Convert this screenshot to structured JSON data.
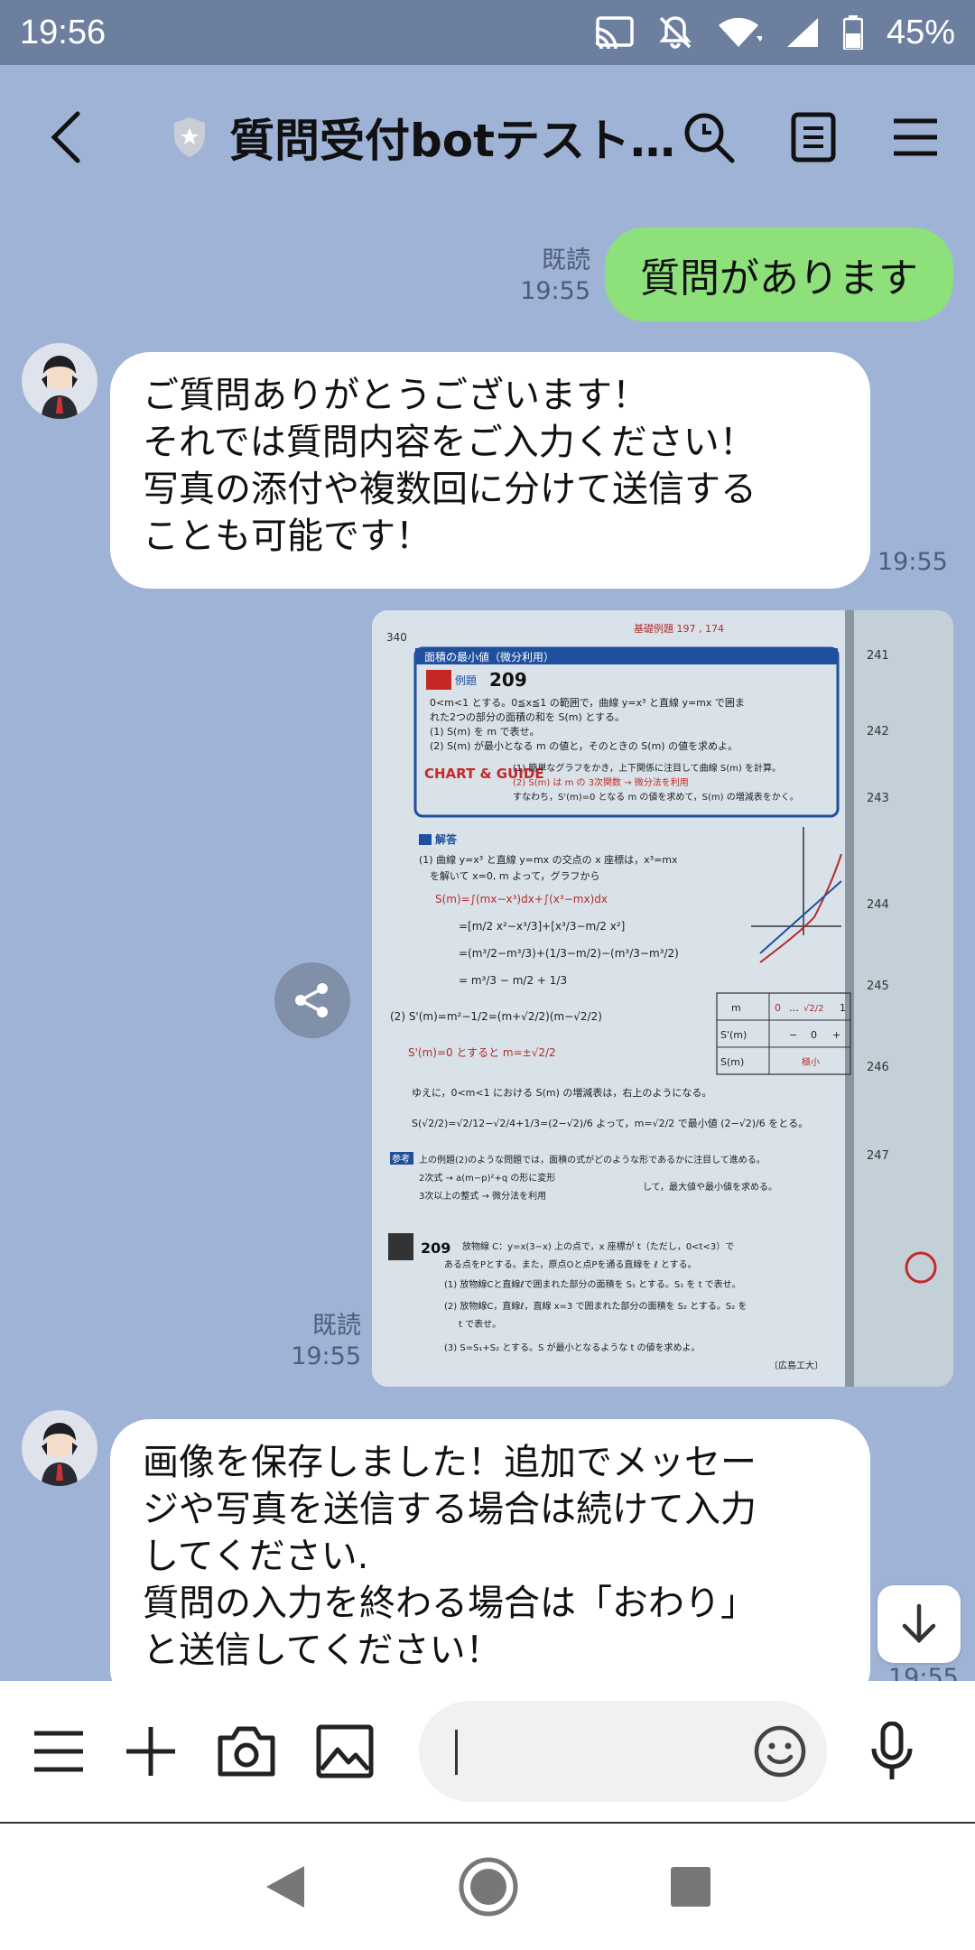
{
  "status_bar": {
    "time": "19:56",
    "battery": "45%"
  },
  "header": {
    "title": "質問受付botテスト…"
  },
  "messages": {
    "m1": {
      "text": "質問があります",
      "read": "既読",
      "time": "19:55"
    },
    "m2": {
      "text": "ご質問ありがとうございます！\nそれでは質問内容をご入力ください！\n写真の添付や複数回に分けて送信する\nことも可能です！",
      "time": "19:55"
    },
    "m3": {
      "read": "既読",
      "time": "19:55",
      "photo_text": {
        "page": "340",
        "heading": "面積の最小値（微分利用）",
        "ex_label": "例題",
        "ex_no": "209",
        "ref": "基礎例題 197 , 174",
        "line1": "0<m<1 とする。0≦x≦1 の範囲で，曲線 y=x³ と直線 y=mx で囲ま",
        "line2": "れた2つの部分の面積の和を S(m) とする。",
        "q1": "(1) S(m) を m で表せ。",
        "q2": "(2) S(m) が最小となる m の値と，そのときの S(m) の値を求めよ。",
        "chart": "CHART & GUIDE",
        "guide1": "(1) 簡単なグラフをかき，上下関係に注目して曲線 S(m) を計算。",
        "guide2": "(2) S(m) は m の 3次関数 → 微分法を利用",
        "guide3": "すなわち，S'(m)=0 となる m の値を求めて，S(m) の増減表をかく。",
        "ans_label": "解答",
        "s1": "(1) 曲線 y=x³ と直線 y=mx の交点の x 座標は，x³=mx",
        "s2": "を解いて x=0, m よって，グラフから",
        "s3": "S(m)=∫(mx−x³)dx+∫(x³−mx)dx",
        "s4": "=[m/2 x²−x³/3]+[x³/3−m/2 x²]",
        "s5": "=(m³/2−m³/3)+(1/3−m/2)−(m³/3−m³/2)",
        "s6": "= m³/3 − m/2 + 1/3",
        "s7": "(2) S'(m)=m²−1/2=(m+√2/2)(m−√2/2)",
        "s8": "S'(m)=0 とすると  m=±√2/2",
        "s9": "ゆえに，0<m<1 における S(m) の増減表は，右上のようになる。",
        "s10": "S(√2/2)=√2/12−√2/4+1/3=(2−√2)/6   よって，m=√2/2 で最小値 (2−√2)/6 をとる。",
        "ref_label": "参考",
        "ref1": "上の例題(2)のような問題では，面積の式がどのような形であるかに注目して進める。",
        "ref2": "2次式 → a(m−p)²+q の形に変形",
        "ref3": "3次以上の整式 → 微分法を利用",
        "ref4": "して，最大値や最小値を求める。",
        "ex2_no": "209",
        "e1": "放物線 C：y=x(3−x) 上の点で，x 座標が t（ただし，0<t<3）で",
        "e2": "ある点をPとする。また，原点Oと点Pを通る直線を ℓ とする。",
        "e3": "(1) 放物線Cと直線ℓで囲まれた部分の面積を S₁ とする。S₁ を t で表せ。",
        "e4": "(2) 放物線C，直線ℓ，直線 x=3 で囲まれた部分の面積を S₂ とする。S₂ を",
        "e5": "t で表せ。",
        "e6": "(3) S=S₁+S₂ とする。S が最小となるような t の値を求めよ。",
        "source": "〔広島工大〕",
        "side1": "241",
        "side2": "242",
        "side3": "243",
        "side4": "244",
        "side5": "245",
        "side6": "246",
        "side7": "247",
        "tbl_m": "m",
        "tbl_sp": "S'(m)",
        "tbl_s": "S(m)",
        "tbl_min": "極小",
        "tbl_zero": "0",
        "tbl_one": "1",
        "tbl_minus": "−",
        "tbl_plus": "+",
        "tbl_val": "√2/2",
        "tbl_dots": "…"
      }
    },
    "m4": {
      "text": "画像を保存しました！追加でメッセー\nジや写真を送信する場合は続けて入力\nしてください.\n質問の入力を終わる場合は「おわり」\nと送信してください！",
      "time": "19:55"
    }
  },
  "icons": {
    "back": "back-arrow-icon",
    "shield": "shield-star-icon",
    "search": "search-icon",
    "notes": "notes-icon",
    "menu": "menu-icon",
    "share": "share-icon",
    "scroll": "arrow-down-icon",
    "keyboard_menu": "menu-icon",
    "plus": "plus-icon",
    "camera": "camera-icon",
    "image": "image-icon",
    "emoji": "emoji-icon",
    "mic": "mic-icon"
  },
  "colors": {
    "chat_bg": "#9fb3d6",
    "out_bubble": "#8de07a",
    "status_bar": "#6d7f9e"
  }
}
